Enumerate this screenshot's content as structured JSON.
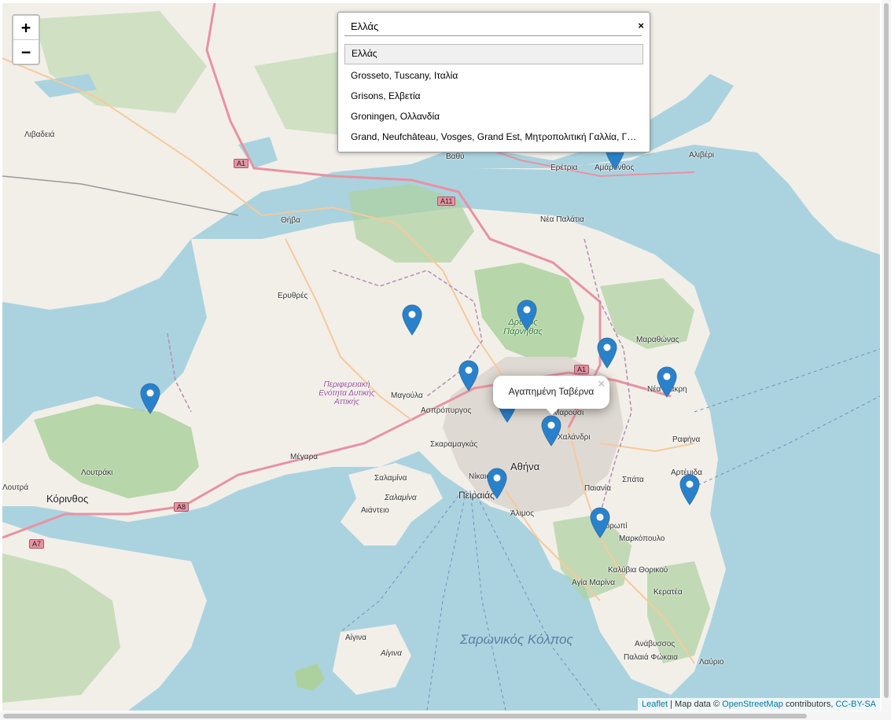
{
  "zoom": {
    "in_label": "+",
    "out_label": "−"
  },
  "search": {
    "value": "Ελλάς",
    "close_label": "×",
    "results": [
      "Ελλάς",
      "Grosseto, Tuscany, Ιταλία",
      "Grisons, Ελβετία",
      "Groningen, Ολλανδία",
      "Grand, Neufchâteau, Vosges, Grand Est, Μητροπολιτική Γαλλία, Γαλλία"
    ]
  },
  "popup": {
    "text": "Αγαπημένη Ταβέρνα",
    "close_label": "×"
  },
  "attribution": {
    "leaflet": "Leaflet",
    "separator": " | Map data © ",
    "osm": "OpenStreetMap",
    "contrib": " contributors, ",
    "license": "CC-BY-SA"
  },
  "places": {
    "livadeia": "Λιβαδειά",
    "thiva": "Θήβα",
    "vathy": "Βαθύ",
    "eretria": "Ερέτρια",
    "amarynthos": "Αμάρυνθος",
    "aliveri": "Αλιβέρι",
    "nea_palatia": "Νέα Παλάτια",
    "erythres": "Ερυθρές",
    "parnitha": "Δρυμός Πάρνηθας",
    "marathonas": "Μαραθώνας",
    "nea_makri": "Νέα Μάκρη",
    "region": "Περιφερειακή Ενότητα Δυτικής Αττικής",
    "magoula": "Μαγούλα",
    "aspropyrgos": "Ασπρόπυργος",
    "marousi": "Μαρούσι",
    "chalandri": "Χαλάνδρι",
    "skaramangas": "Σκαραμαγκάς",
    "megara": "Μέγαρα",
    "athina": "Αθήνα",
    "nikaia": "Νίκαια",
    "peiraias": "Πειραιάς",
    "rafina": "Ραφήνα",
    "spata": "Σπάτα",
    "paiania": "Παιανία",
    "artemida": "Αρτέμιδα",
    "salamina": "Σαλαμίνα",
    "salamina_isl": "Σαλαμίνα",
    "aiantio": "Αιάντειο",
    "loutraki": "Λουτράκι",
    "korinthos": "Κόρινθος",
    "alimos": "Άλιμος",
    "koropi": "Κορωπί",
    "markopoulo": "Μαρκόπουλο",
    "kalyvia": "Καλύβια Θορικού",
    "agia_marina": "Αγία Μαρίνα",
    "keratea": "Κερατέα",
    "saronikos": "Σαρωνικός Κόλπος",
    "aigina": "Αίγινα",
    "aigina_isl": "Αίγινα",
    "anavyssos": "Ανάβυσσος",
    "palaia_fokaia": "Παλαιά Φώκαια",
    "lavrio": "Λαύριο",
    "loutra": "Λουτρά"
  },
  "roads": {
    "a1": "A1",
    "a11": "A11",
    "a1b": "A1",
    "a8": "A8",
    "a7": "A7"
  },
  "colors": {
    "water": "#aad3df",
    "land": "#f2efe9",
    "forest": "#add19e",
    "motorway": "#e892a2",
    "marker": "#2a81cb"
  },
  "markers": [
    "marker-euboea-amarynthos",
    "marker-west-attica-north",
    "marker-parnitha",
    "marker-kifisia",
    "marker-nea-makri",
    "marker-fyli",
    "marker-perama-west",
    "marker-athens-center",
    "marker-piraeus",
    "marker-artemida",
    "marker-koropi",
    "marker-corinth-gulf"
  ]
}
